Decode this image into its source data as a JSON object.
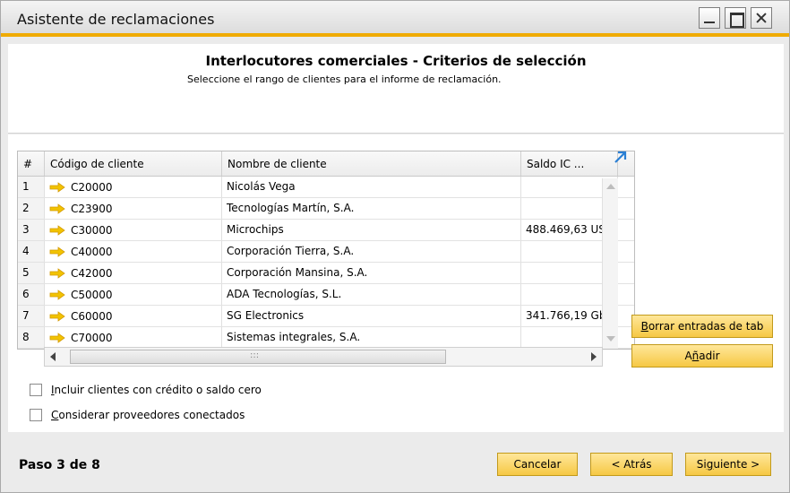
{
  "window": {
    "title": "Asistente de reclamaciones"
  },
  "header": {
    "title": "Interlocutores comerciales - Criterios de selección",
    "subtitle": "Seleccione el rango de clientes para el informe de reclamación."
  },
  "grid": {
    "columns": {
      "num": "#",
      "code": "Código de cliente",
      "name": "Nombre de cliente",
      "balance": "Saldo IC ..."
    },
    "rows": [
      {
        "num": "1",
        "code": "C20000",
        "name": "Nicolás Vega",
        "balance": ""
      },
      {
        "num": "2",
        "code": "C23900",
        "name": "Tecnologías Martín, S.A.",
        "balance": ""
      },
      {
        "num": "3",
        "code": "C30000",
        "name": "Microchips",
        "balance": "488.469,63 US"
      },
      {
        "num": "4",
        "code": "C40000",
        "name": "Corporación Tierra, S.A.",
        "balance": ""
      },
      {
        "num": "5",
        "code": "C42000",
        "name": "Corporación Mansina, S.A.",
        "balance": ""
      },
      {
        "num": "6",
        "code": "C50000",
        "name": "ADA Tecnologías, S.L.",
        "balance": ""
      },
      {
        "num": "7",
        "code": "C60000",
        "name": "SG Electronics",
        "balance": "341.766,19 Gb"
      },
      {
        "num": "8",
        "code": "C70000",
        "name": "Sistemas integrales, S.A.",
        "balance": ""
      }
    ]
  },
  "side_buttons": {
    "clear": "Borrar entradas de tab",
    "add": "Añadir"
  },
  "options": {
    "zero_balance": "Incluir clientes con crédito o saldo cero",
    "connected_vendors": "Considerar proveedores conectados"
  },
  "footer": {
    "step": "Paso 3 de 8",
    "cancel": "Cancelar",
    "back": "< Atrás",
    "next": "Siguiente >"
  },
  "colors": {
    "accent": "#f0ab00",
    "button": "#f6c844",
    "arrow": "#f2c300"
  }
}
